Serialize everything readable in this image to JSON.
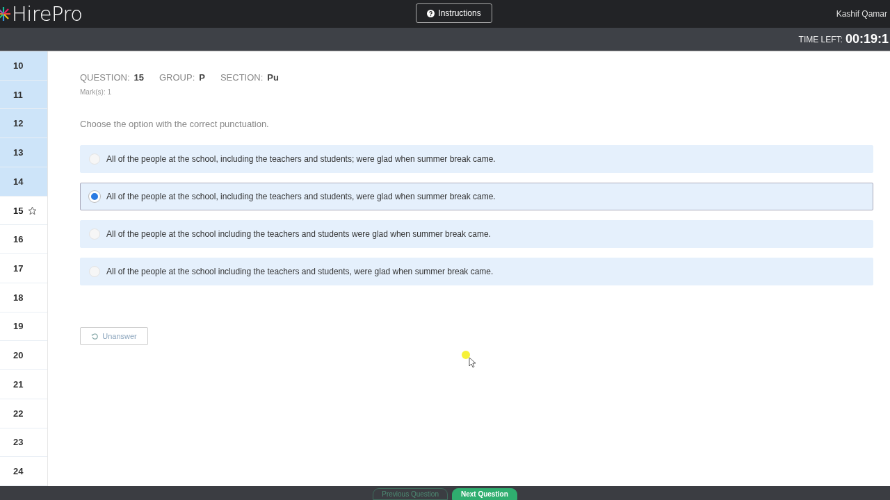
{
  "header": {
    "logo": "HirePro",
    "instructions_button": "Instructions",
    "user_name": "Kashif Qamar"
  },
  "timer": {
    "label": "TIME LEFT:",
    "value": "00:19:1"
  },
  "sidebar": {
    "items": [
      {
        "label": "10",
        "answered": true,
        "selected": false
      },
      {
        "label": "11",
        "answered": true,
        "selected": false
      },
      {
        "label": "12",
        "answered": true,
        "selected": false
      },
      {
        "label": "13",
        "answered": true,
        "selected": false
      },
      {
        "label": "14",
        "answered": true,
        "selected": false
      },
      {
        "label": "15",
        "answered": false,
        "selected": true
      },
      {
        "label": "16",
        "answered": false,
        "selected": false
      },
      {
        "label": "17",
        "answered": false,
        "selected": false
      },
      {
        "label": "18",
        "answered": false,
        "selected": false
      },
      {
        "label": "19",
        "answered": false,
        "selected": false
      },
      {
        "label": "20",
        "answered": false,
        "selected": false
      },
      {
        "label": "21",
        "answered": false,
        "selected": false
      },
      {
        "label": "22",
        "answered": false,
        "selected": false
      },
      {
        "label": "23",
        "answered": false,
        "selected": false
      },
      {
        "label": "24",
        "answered": false,
        "selected": false
      }
    ]
  },
  "question": {
    "meta": [
      {
        "label": "QUESTION:",
        "value": "15"
      },
      {
        "label": "GROUP:",
        "value": "P"
      },
      {
        "label": "SECTION:",
        "value": "Pu"
      }
    ],
    "marks": "Mark(s):  1",
    "prompt": "Choose the option with the correct punctuation.",
    "options": [
      {
        "text": "All of the people at the school, including the teachers and students; were glad when summer break came.",
        "selected": false
      },
      {
        "text": "All of the people at the school, including the teachers and students, were glad when summer break came.",
        "selected": true
      },
      {
        "text": "All of the people at the school including the teachers and students were glad when summer break came.",
        "selected": false
      },
      {
        "text": "All of the people at the school including the teachers and students, were glad when summer break came.",
        "selected": false
      }
    ],
    "unanswer_button": "Unanswer"
  },
  "footer": {
    "buttons": [
      "Previous Question",
      "Next Question"
    ]
  }
}
